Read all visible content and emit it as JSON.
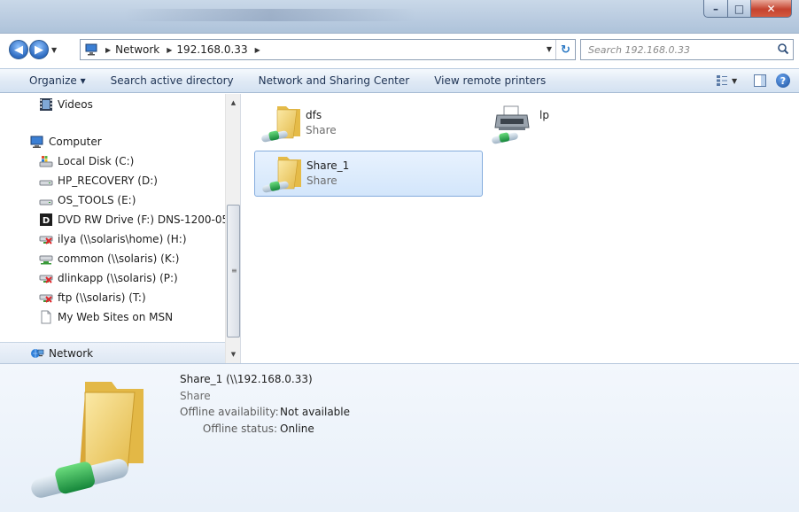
{
  "window": {
    "caption_buttons": {
      "minimize": "–",
      "maximize": "□",
      "close": "✕"
    }
  },
  "navigation": {
    "back_icon": "back-arrow-icon",
    "forward_icon": "forward-arrow-icon",
    "breadcrumbs": [
      "Network",
      "192.168.0.33"
    ],
    "search_placeholder": "Search 192.168.0.33"
  },
  "toolbar": {
    "organize": "Organize ▾",
    "search_ad": "Search active directory",
    "nsc": "Network and Sharing Center",
    "printers": "View remote printers"
  },
  "sidebar": {
    "items": [
      {
        "label": "Videos",
        "icon": "videos-icon"
      },
      {
        "label": "Computer",
        "icon": "computer-icon"
      },
      {
        "label": "Local Disk (C:)",
        "icon": "local-disk-icon"
      },
      {
        "label": "HP_RECOVERY (D:)",
        "icon": "drive-icon"
      },
      {
        "label": "OS_TOOLS (E:)",
        "icon": "drive-icon"
      },
      {
        "label": "DVD RW Drive (F:) DNS-1200-05",
        "icon": "dvd-drive-icon"
      },
      {
        "label": "ilya (\\\\solaris\\home) (H:)",
        "icon": "disconnected-network-drive-icon"
      },
      {
        "label": "common (\\\\solaris) (K:)",
        "icon": "network-drive-icon"
      },
      {
        "label": "dlinkapp (\\\\solaris) (P:)",
        "icon": "disconnected-network-drive-icon"
      },
      {
        "label": "ftp (\\\\solaris) (T:)",
        "icon": "disconnected-network-drive-icon"
      },
      {
        "label": "My Web Sites on MSN",
        "icon": "document-icon"
      },
      {
        "label": "Network",
        "icon": "network-icon"
      }
    ]
  },
  "content": {
    "items": [
      {
        "name": "dfs",
        "type": "Share",
        "icon": "shared-folder-icon"
      },
      {
        "name": "lp",
        "type": "",
        "icon": "printer-icon"
      },
      {
        "name": "Share_1",
        "type": "Share",
        "icon": "shared-folder-icon",
        "selected": true
      }
    ]
  },
  "details": {
    "title": "Share_1 (\\\\192.168.0.33)",
    "type": "Share",
    "fields": [
      {
        "label": "Offline availability:",
        "value": "Not available"
      },
      {
        "label": "Offline status:",
        "value": "Online"
      }
    ]
  },
  "colors": {
    "selection_bg": "#d3e6fb",
    "selection_border": "#84acdd",
    "folder_yellow": "#f2cf6a",
    "share_green": "#2aa84a"
  }
}
